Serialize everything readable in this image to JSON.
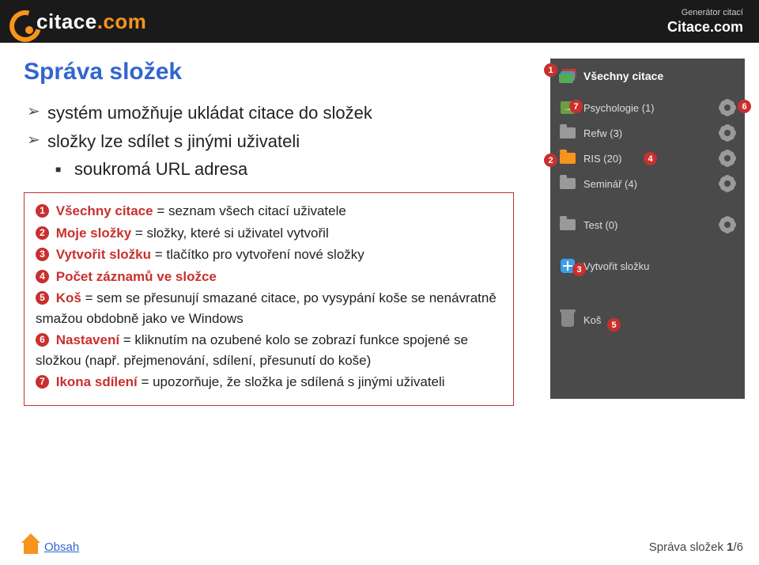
{
  "header": {
    "logo_main": "citace",
    "logo_suffix": ".com",
    "subtitle": "Generátor citací",
    "title": "Citace.com"
  },
  "content": {
    "title": "Správa složek",
    "bullet1": "systém umožňuje ukládat citace do složek",
    "bullet2": "složky lze sdílet s jinými uživateli",
    "bullet2_sub": "soukromá URL adresa"
  },
  "legend": {
    "l1_k": "Všechny citace",
    "l1_t": " = seznam všech citací uživatele",
    "l2_k": "Moje složky",
    "l2_t": " = složky, které si uživatel vytvořil",
    "l3_k": "Vytvořit složku",
    "l3_t": " = tlačítko pro vytvoření nové složky",
    "l4_k": "Počet záznamů ve složce",
    "l5_k": "Koš",
    "l5_t": " = sem se přesunují smazané citace, po vysypání koše se nenávratně smažou obdobně jako ve Windows",
    "l6_k": "Nastavení",
    "l6_t": " = kliknutím na ozubené kolo se zobrazí funkce spojené se složkou (např. přejmenování, sdílení, přesunutí do koše)",
    "l7_k": "Ikona sdílení",
    "l7_t": " = upozorňuje, že složka je sdílená s jinými uživateli"
  },
  "sidebar": {
    "all": "Všechny citace",
    "items": [
      {
        "label": "Psychologie (1)"
      },
      {
        "label": "Refw (3)"
      },
      {
        "label": "RIS (20)"
      },
      {
        "label": "Seminář (4)"
      },
      {
        "label": "Test (0)"
      }
    ],
    "create": "Vytvořit složku",
    "trash": "Koš"
  },
  "markers": {
    "m1": "1",
    "m2": "2",
    "m3": "3",
    "m4": "4",
    "m5": "5",
    "m6": "6",
    "m7": "7"
  },
  "footer": {
    "link": "Obsah",
    "right_label": "Správa složek ",
    "page_current": "1",
    "page_sep": "/",
    "page_total": "6"
  }
}
